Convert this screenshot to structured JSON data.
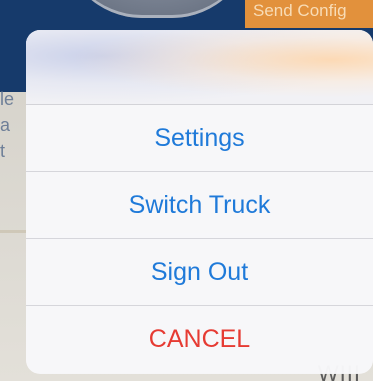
{
  "background": {
    "send_config_label": "Send Config",
    "left_label": "le a t",
    "bottom_label": "WIII"
  },
  "action_sheet": {
    "options": [
      {
        "label": "Settings"
      },
      {
        "label": "Switch Truck"
      },
      {
        "label": "Sign Out"
      }
    ],
    "cancel_label": "CANCEL"
  },
  "colors": {
    "action_blue": "#1f7ad9",
    "cancel_red": "#e63b33",
    "send_config_orange": "#e2913c",
    "app_header_navy": "#163a6b"
  }
}
